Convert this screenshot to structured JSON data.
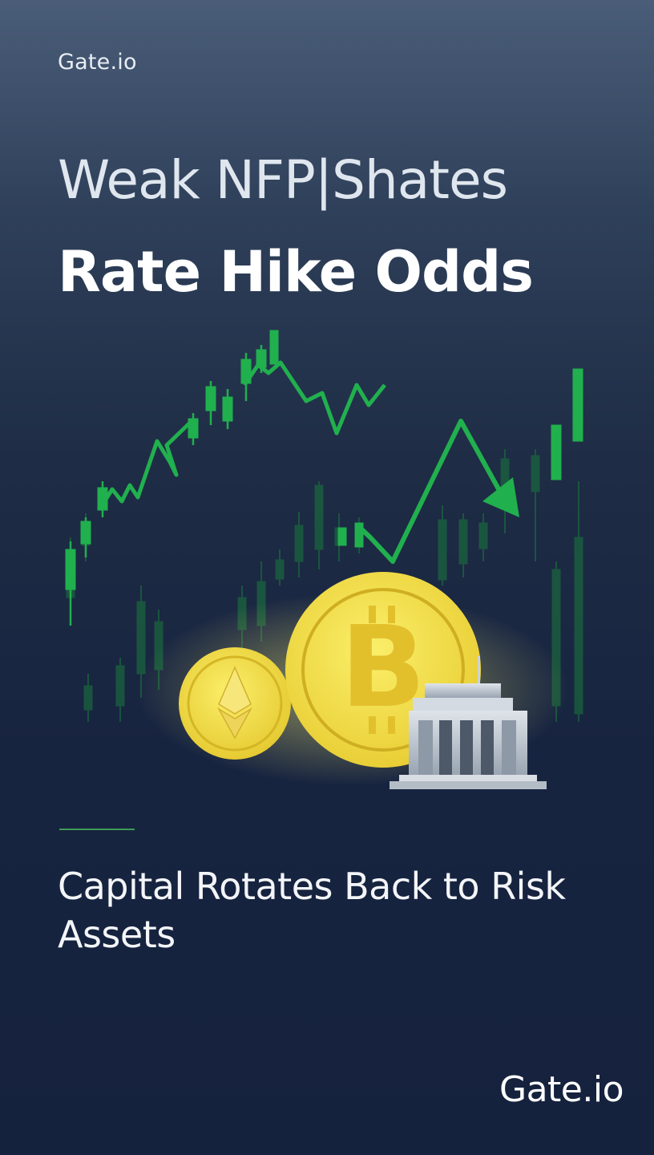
{
  "brand": {
    "top_label": "Gate.io",
    "bottom_label": "Gate.io"
  },
  "headline": {
    "line1": "Weak NFP|Shates",
    "line2": "Rate Hike Odds"
  },
  "subheadline": "Capital Rotates Back to Risk Assets",
  "illustration": {
    "icons": [
      "candlestick-chart-icon",
      "trend-arrow-icon",
      "ethereum-coin-icon",
      "bitcoin-coin-icon",
      "bank-building-icon"
    ],
    "colors": {
      "up": "#1fa84a",
      "coin": "#f2e045",
      "coin_dark": "#d9b92a",
      "bank": "#c4ccd6"
    }
  }
}
